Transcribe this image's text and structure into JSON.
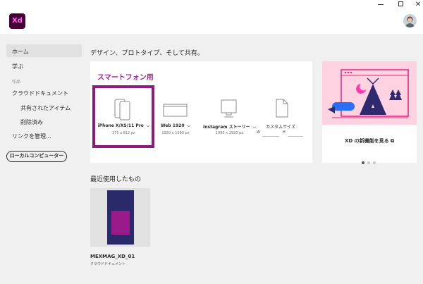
{
  "app": {
    "logo_text": "Xd"
  },
  "window_controls": {
    "close_glyph": "✕"
  },
  "sidebar": {
    "home": "ホーム",
    "learn": "学ぶ",
    "section_works": "作品",
    "cloud_documents": "クラウドドキュメント",
    "shared": "共有されたアイテム",
    "deleted": "削除済み",
    "manage_links": "リンクを管理...",
    "local_button": "ローカルコンピューター"
  },
  "main": {
    "title": "デザイン、プロトタイプ、そして共有。",
    "presets_title": "スマートフォン用",
    "presets": [
      {
        "label": "iPhone X/XS/11 Pro",
        "size": "375 x 812 px",
        "icon": "phone-icon",
        "selected": true
      },
      {
        "label": "Web 1920",
        "size": "1920 x 1080 px",
        "icon": "web-icon"
      },
      {
        "label": "Instagram ストーリー",
        "size": "1080 x 1920 px",
        "icon": "instagram-icon"
      },
      {
        "label": "カスタムサイズ",
        "w_label": "W",
        "h_label": "H",
        "icon": "custom-size-icon"
      }
    ],
    "whats_new": "XD の新機能を見る",
    "carousel_count": 3,
    "recent_title": "最近使用したもの",
    "recent_files": [
      {
        "name": "MEXMAG_XD_01",
        "location": "クラウドドキュメント"
      }
    ]
  },
  "colors": {
    "accent": "#8c1a7f",
    "logo_bg": "#470137",
    "logo_fg": "#ff61f6",
    "promo_bg": "#ffd2e2"
  }
}
